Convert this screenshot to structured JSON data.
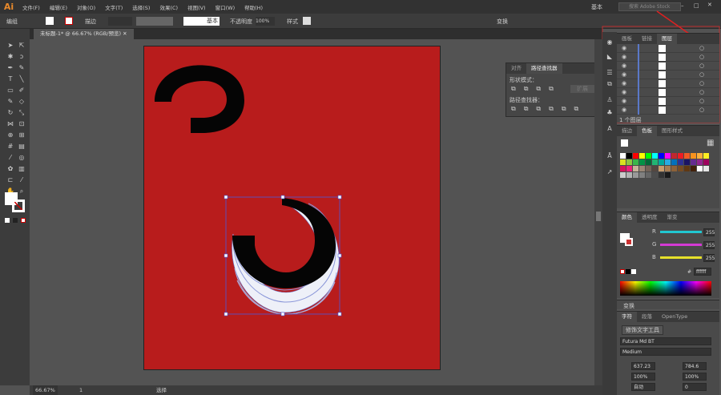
{
  "app": {
    "logo": "Ai",
    "menus": [
      "文件(F)",
      "编辑(E)",
      "对象(O)",
      "文字(T)",
      "选择(S)",
      "效果(C)",
      "视图(V)",
      "窗口(W)",
      "帮助(H)"
    ],
    "workspace": "基本",
    "search_placeholder": "搜索 Adobe Stock"
  },
  "control": {
    "label": "编组",
    "stroke_label": "描边",
    "brush": "基本",
    "opacity_label": "不透明度",
    "opacity": "100%",
    "style_label": "样式",
    "transform": "变换"
  },
  "document": {
    "tab": "未标题-1* @ 66.67% (RGB/预览)"
  },
  "pathfinder": {
    "tabs": [
      "对齐",
      "路径查找器"
    ],
    "shape_modes": "形状模式：",
    "expand": "扩展",
    "pathfinders": "路径查找器："
  },
  "layers": {
    "tabs": [
      "画板",
      "链接",
      "图层"
    ],
    "count": "1 个图层",
    "rows": 8
  },
  "swatches": {
    "tabs": [
      "描边",
      "色板",
      "图形样式"
    ],
    "colors": [
      "#ffffff",
      "#000000",
      "#ff0000",
      "#ffff00",
      "#00ff00",
      "#00ffff",
      "#0000ff",
      "#ff00ff",
      "#c1272d",
      "#ed1c24",
      "#f15a24",
      "#f7931e",
      "#fbb03b",
      "#fcee21",
      "#d9e021",
      "#8cc63f",
      "#39b54a",
      "#009245",
      "#006837",
      "#22b573",
      "#00a99d",
      "#29abe2",
      "#0071bc",
      "#2e3192",
      "#1b1464",
      "#662d91",
      "#93278f",
      "#9e005d",
      "#d4145a",
      "#ed1e79",
      "#c7b299",
      "#998675",
      "#736357",
      "#534741",
      "#c69c6d",
      "#a67c52",
      "#8c6239",
      "#754c24",
      "#603813",
      "#42210b",
      "#ffffff",
      "#e6e6e6",
      "#cccccc",
      "#b3b3b3",
      "#999999",
      "#808080",
      "#666666",
      "#4d4d4d",
      "#333333",
      "#1a1a1a"
    ]
  },
  "color": {
    "tabs": [
      "颜色",
      "透明度",
      "渐变"
    ],
    "channels": [
      {
        "label": "R",
        "value": "255",
        "color": "#21c7d0"
      },
      {
        "label": "G",
        "value": "255",
        "color": "#d43ad4"
      },
      {
        "label": "B",
        "value": "255",
        "color": "#e6e02a"
      }
    ],
    "hex": "ffffff"
  },
  "transform": {
    "title": "变换"
  },
  "character": {
    "tabs": [
      "字符",
      "段落",
      "OpenType"
    ],
    "touch_tool": "修饰文字工具",
    "font": "Futura Md BT",
    "style": "Medium",
    "size": "637.23",
    "leading": "784.6",
    "vscale": "100%",
    "hscale": "100%",
    "kerning": "自动",
    "tracking": "0"
  },
  "status": {
    "zoom": "66.67%",
    "page": "1",
    "tool": "选择"
  },
  "artboard_color": "#b81c1c"
}
